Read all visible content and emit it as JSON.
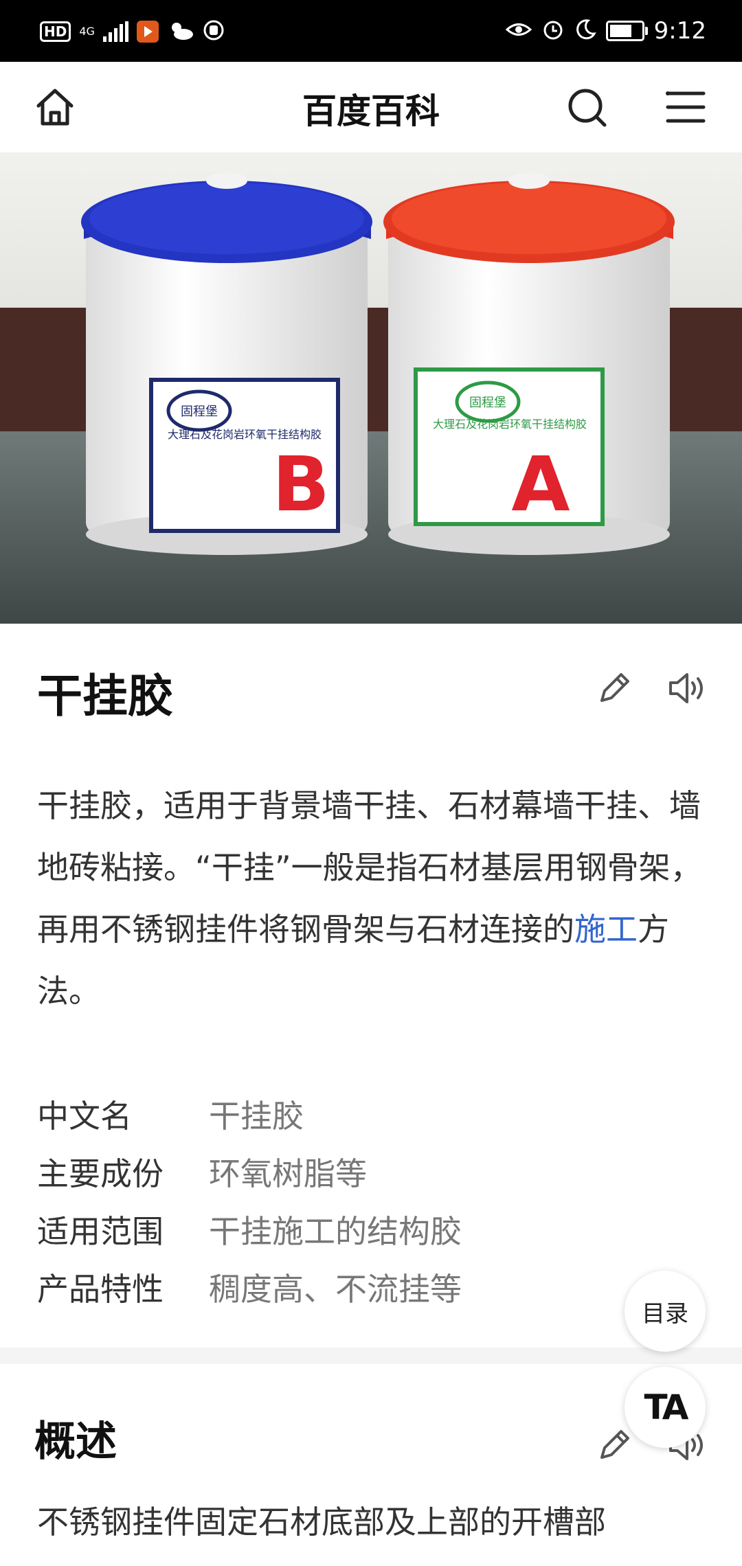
{
  "status_bar": {
    "hd": "HD",
    "network": "4G",
    "time": "9:12",
    "battery_level": 0.7
  },
  "header": {
    "title": "百度百科",
    "home_icon": "home-icon",
    "search_icon": "search-icon",
    "menu_icon": "menu-icon"
  },
  "hero": {
    "bucket_left": {
      "brand": "固程堡",
      "label": "大理石及花岗岩环氧干挂结构胶",
      "letter": "B",
      "lid_color": "#1f2fb0",
      "frame_color": "#1f2a6b"
    },
    "bucket_right": {
      "brand": "固程堡",
      "label": "大理石及花岗岩环氧干挂结构胶",
      "letter": "A",
      "lid_color": "#e8321f",
      "frame_color": "#2e9a45"
    }
  },
  "article": {
    "title": "干挂胶",
    "edit_icon": "pencil-icon",
    "audio_icon": "speaker-icon",
    "summary_before": "干挂胶，适用于背景墙干挂、石材幕墙干挂、墙地砖粘接。“干挂”一般是指石材基层用钢骨架，再用不锈钢挂件将钢骨架与石材连接的",
    "summary_link": "施工",
    "summary_after": "方法。",
    "infobox": [
      {
        "key": "中文名",
        "value": "干挂胶"
      },
      {
        "key": "主要成份",
        "value": "环氧树脂等"
      },
      {
        "key": "适用范围",
        "value": "干挂施工的结构胶"
      },
      {
        "key": "产品特性",
        "value": "稠度高、不流挂等"
      }
    ]
  },
  "section": {
    "title": "概述",
    "text": "不锈钢挂件固定石材底部及上部的开槽部"
  },
  "floating": {
    "toc_label": "目录",
    "ta_label": "TA"
  },
  "colors": {
    "link": "#3366cc",
    "accent_text": "#333333"
  }
}
